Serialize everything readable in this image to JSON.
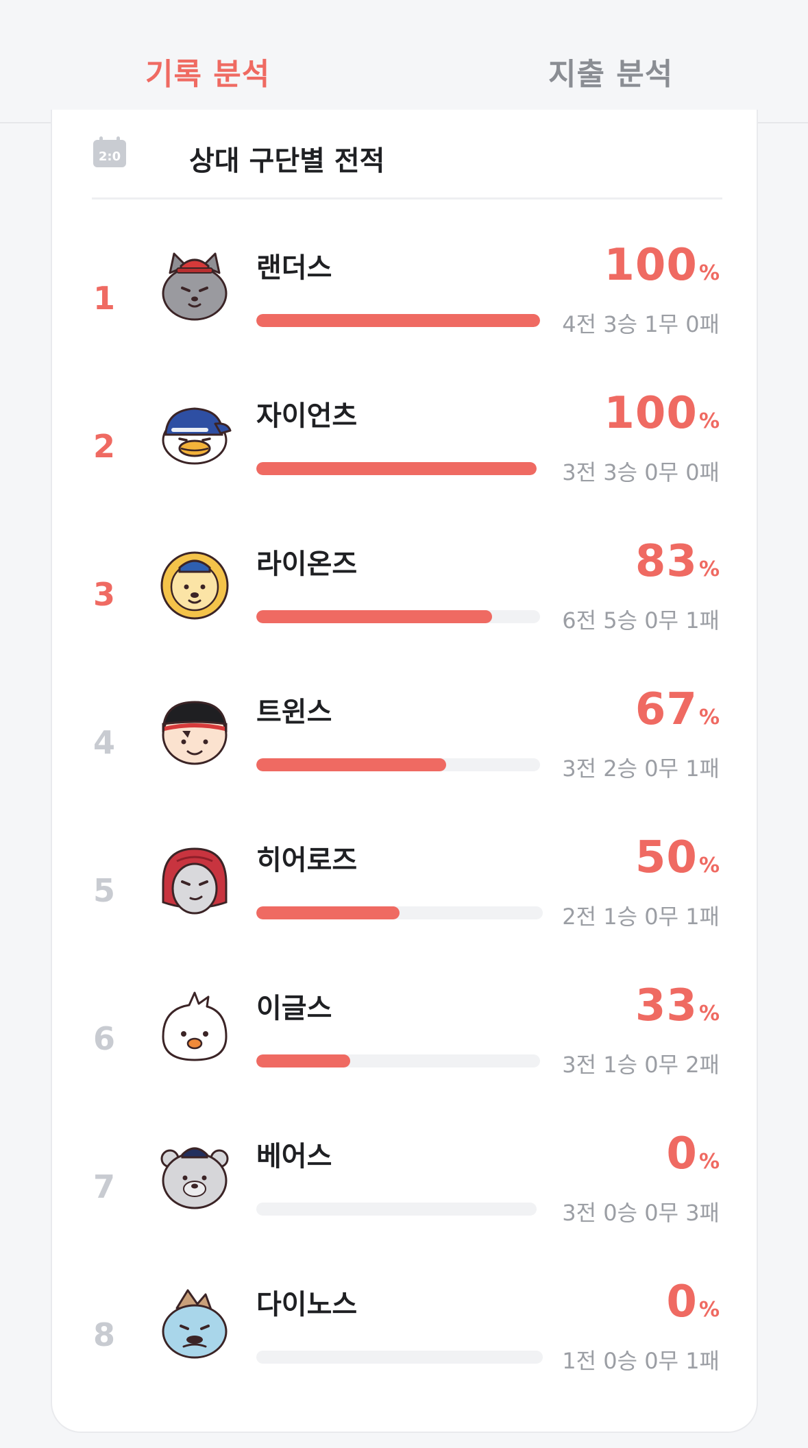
{
  "tabs": [
    {
      "label": "기록 분석",
      "active": true
    },
    {
      "label": "지출 분석",
      "active": false
    }
  ],
  "colors": {
    "accent": "#ef6a62",
    "muted": "#c8cbd1",
    "track": "#f1f2f4"
  },
  "card": {
    "icon": "calendar-icon",
    "title": "상대 구단별 전적"
  },
  "rows": [
    {
      "rank": "1",
      "team": "랜더스",
      "avatar": "landers-mascot-icon",
      "percent": "100",
      "percent_sign": "%",
      "win_rate": 1.0,
      "record": "4전 3승 1무 0패"
    },
    {
      "rank": "2",
      "team": "자이언츠",
      "avatar": "giants-mascot-icon",
      "percent": "100",
      "percent_sign": "%",
      "win_rate": 1.0,
      "record": "3전 3승 0무 0패"
    },
    {
      "rank": "3",
      "team": "라이온즈",
      "avatar": "lions-mascot-icon",
      "percent": "83",
      "percent_sign": "%",
      "win_rate": 0.83,
      "record": "6전 5승 0무 1패"
    },
    {
      "rank": "4",
      "team": "트윈스",
      "avatar": "twins-mascot-icon",
      "percent": "67",
      "percent_sign": "%",
      "win_rate": 0.67,
      "record": "3전 2승 0무 1패"
    },
    {
      "rank": "5",
      "team": "히어로즈",
      "avatar": "heroes-mascot-icon",
      "percent": "50",
      "percent_sign": "%",
      "win_rate": 0.5,
      "record": "2전 1승 0무 1패"
    },
    {
      "rank": "6",
      "team": "이글스",
      "avatar": "eagles-mascot-icon",
      "percent": "33",
      "percent_sign": "%",
      "win_rate": 0.33,
      "record": "3전 1승 0무 2패"
    },
    {
      "rank": "7",
      "team": "베어스",
      "avatar": "bears-mascot-icon",
      "percent": "0",
      "percent_sign": "%",
      "win_rate": 0.0,
      "record": "3전 0승 0무 3패"
    },
    {
      "rank": "8",
      "team": "다이노스",
      "avatar": "dinos-mascot-icon",
      "percent": "0",
      "percent_sign": "%",
      "win_rate": 0.0,
      "record": "1전 0승 0무 1패"
    }
  ]
}
